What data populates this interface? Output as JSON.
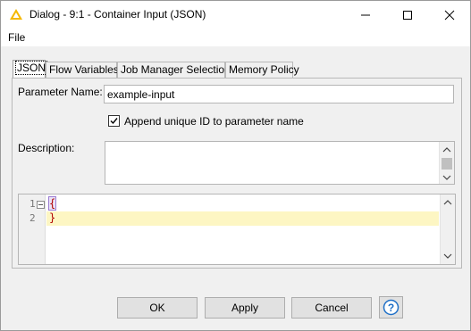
{
  "window": {
    "title": "Dialog - 9:1 - Container Input (JSON)",
    "minimize_icon": "minimize-icon",
    "maximize_icon": "maximize-icon",
    "close_icon": "close-icon",
    "app_icon": "knime-app-icon"
  },
  "menu": {
    "file_label": "File"
  },
  "tabs": [
    {
      "label": "JSON",
      "active": true
    },
    {
      "label": "Flow Variables",
      "active": false
    },
    {
      "label": "Job Manager Selection",
      "active": false
    },
    {
      "label": "Memory Policy",
      "active": false
    }
  ],
  "form": {
    "parameter_name_label": "Parameter Name:",
    "parameter_name_value": "example-input",
    "append_id_label": "Append unique ID to parameter name",
    "append_id_checked": true,
    "description_label": "Description:",
    "description_value": ""
  },
  "editor": {
    "lines": [
      {
        "number": "1",
        "text": "{"
      },
      {
        "number": "2",
        "text": "}"
      }
    ]
  },
  "buttons": {
    "ok": "OK",
    "apply": "Apply",
    "cancel": "Cancel",
    "help_icon": "help-icon"
  },
  "colors": {
    "accent": "#1e6fc7",
    "code_brace": "#b00000",
    "current_line": "#fdf6c3",
    "app_icon": "#f5b800"
  }
}
